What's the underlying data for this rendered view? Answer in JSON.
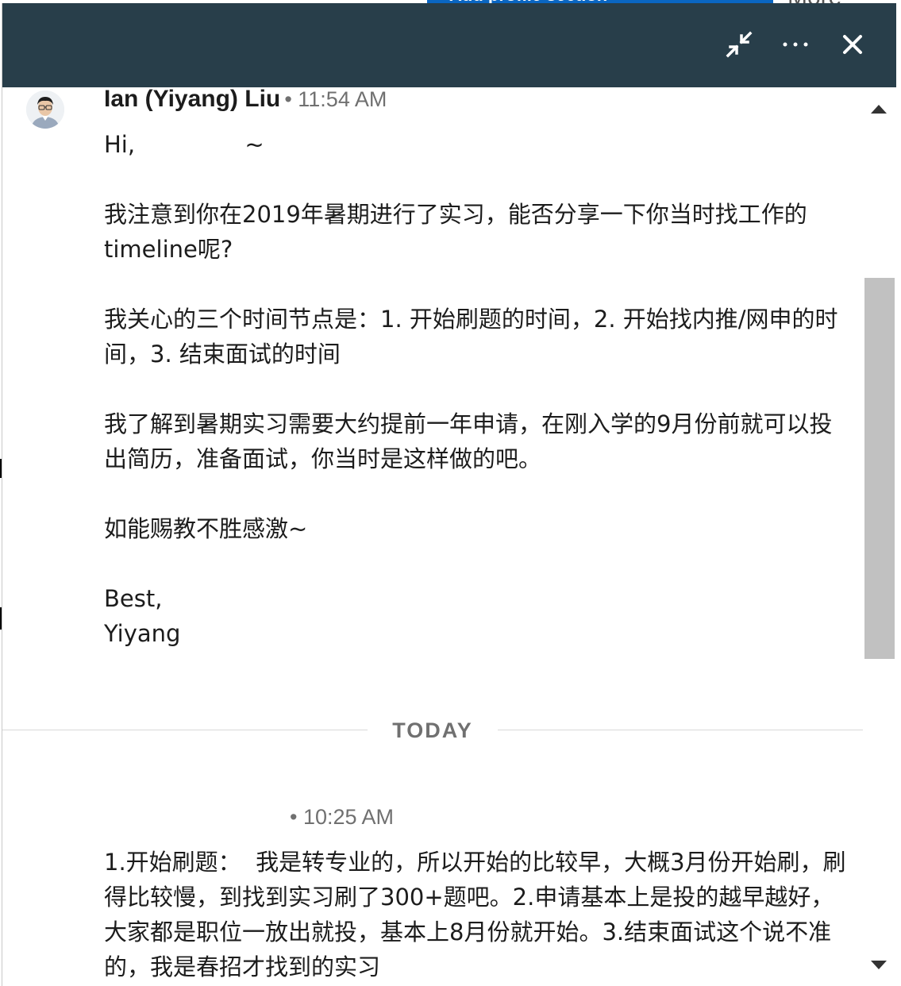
{
  "background": {
    "section_button_label": "Add profile section",
    "more_label": "More"
  },
  "header": {
    "minimize_icon": "collapse-arrows-icon",
    "more_icon": "ellipsis-icon",
    "close_icon": "close-icon",
    "bg_color": "#283e4a"
  },
  "messages": [
    {
      "sender": "Ian (Yiyang) Liu",
      "time": "• 11:54 AM",
      "body": "Hi,               ~\n\n我注意到你在2019年暑期进行了实习，能否分享一下你当时找工作的timeline呢?\n\n我关心的三个时间节点是：1. 开始刷题的时间，2. 开始找内推/网申的时间，3. 结束面试的时间\n\n我了解到暑期实习需要大约提前一年申请，在刚入学的9月份前就可以投出简历，准备面试，你当时是这样做的吧。\n\n如能赐教不胜感激~\n\nBest,\nYiyang"
    },
    {
      "sender": "",
      "time": "• 10:25 AM",
      "body": "1.开始刷题：  我是转专业的，所以开始的比较早，大概3月份开始刷，刷得比较慢，到找到实习刷了300+题吧。2.申请基本上是投的越早越好，大家都是职位一放出就投，基本上8月份就开始。3.结束面试这个说不准的，我是春招才找到的实习"
    }
  ],
  "divider": {
    "label": "TODAY"
  }
}
